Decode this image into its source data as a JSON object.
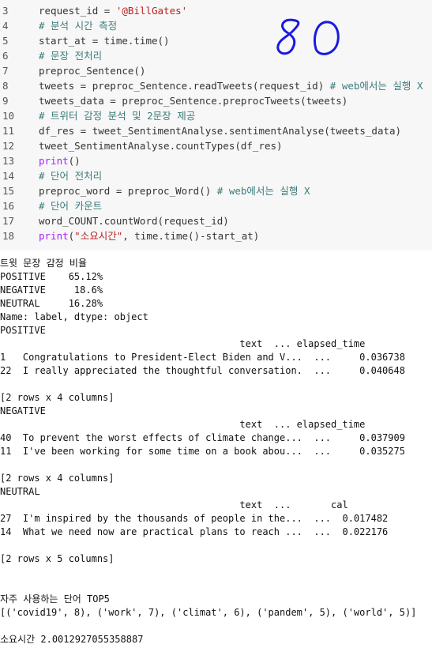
{
  "code_lines": [
    {
      "n": "3",
      "text": "request_id = '@BillGates'",
      "cls": "str-part",
      "parts": [
        {
          "t": "request_id = ",
          "c": ""
        },
        {
          "t": "'@BillGates'",
          "c": "str"
        }
      ]
    },
    {
      "n": "4",
      "parts": [
        {
          "t": "# 분석 시간 측정",
          "c": "cmt"
        }
      ]
    },
    {
      "n": "5",
      "parts": [
        {
          "t": "start_at = time.time()",
          "c": ""
        }
      ]
    },
    {
      "n": "6",
      "parts": [
        {
          "t": "# 문장 전처리",
          "c": "cmt"
        }
      ]
    },
    {
      "n": "7",
      "parts": [
        {
          "t": "preproc_Sentence()",
          "c": ""
        }
      ]
    },
    {
      "n": "8",
      "parts": [
        {
          "t": "tweets = preproc_Sentence.readTweets(request_id) ",
          "c": ""
        },
        {
          "t": "# web에서는 실행 X",
          "c": "cmt"
        }
      ]
    },
    {
      "n": "9",
      "parts": [
        {
          "t": "tweets_data = preproc_Sentence.preprocTweets(tweets)",
          "c": ""
        }
      ]
    },
    {
      "n": "10",
      "parts": [
        {
          "t": "# 트위터 감정 분석 및 2문장 제공",
          "c": "cmt"
        }
      ]
    },
    {
      "n": "11",
      "parts": [
        {
          "t": "df_res = tweet_SentimentAnalyse.sentimentAnalyse(tweets_data)",
          "c": ""
        }
      ]
    },
    {
      "n": "12",
      "parts": [
        {
          "t": "tweet_SentimentAnalyse.countTypes(df_res)",
          "c": ""
        }
      ]
    },
    {
      "n": "13",
      "parts": [
        {
          "t": "print",
          "c": "kw"
        },
        {
          "t": "()",
          "c": ""
        }
      ]
    },
    {
      "n": "14",
      "parts": [
        {
          "t": "# 단어 전처리",
          "c": "cmt"
        }
      ]
    },
    {
      "n": "15",
      "parts": [
        {
          "t": "preproc_word = preproc_Word() ",
          "c": ""
        },
        {
          "t": "# web에서는 실행 X",
          "c": "cmt"
        }
      ]
    },
    {
      "n": "16",
      "parts": [
        {
          "t": "# 단어 카운트",
          "c": "cmt"
        }
      ]
    },
    {
      "n": "17",
      "parts": [
        {
          "t": "word_COUNT.countWord(request_id)",
          "c": ""
        }
      ]
    },
    {
      "n": "18",
      "parts": [
        {
          "t": "print",
          "c": "kw"
        },
        {
          "t": "(",
          "c": ""
        },
        {
          "t": "\"소요시간\"",
          "c": "str"
        },
        {
          "t": ", time.time()-start_at)",
          "c": ""
        }
      ]
    }
  ],
  "handwritten_note": "80",
  "output_lines": [
    "트윗 문장 감정 비율",
    "POSITIVE    65.12%",
    "NEGATIVE     18.6%",
    "NEUTRAL     16.28%",
    "Name: label, dtype: object",
    "POSITIVE",
    "                                          text  ... elapsed_time",
    "1   Congratulations to President-Elect Biden and V...  ...     0.036738",
    "22  I really appreciated the thoughtful conversation.  ...     0.040648",
    "",
    "[2 rows x 4 columns]",
    "NEGATIVE",
    "                                          text  ... elapsed_time",
    "40  To prevent the worst effects of climate change...  ...     0.037909",
    "11  I've been working for some time on a book abou...  ...     0.035275",
    "",
    "[2 rows x 4 columns]",
    "NEUTRAL",
    "                                          text  ...       cal",
    "27  I'm inspired by the thousands of people in the...  ...  0.017482",
    "14  What we need now are practical plans to reach ...  ...  0.022176",
    "",
    "[2 rows x 5 columns]",
    "",
    "",
    "자주 사용하는 단어 TOP5",
    "[('covid19', 8), ('work', 7), ('climat', 6), ('pandem', 5), ('world', 5)]",
    "",
    "소요시간 2.0012927055358887"
  ],
  "colors": {
    "code_bg": "#f7f7f7",
    "string": "#ba2121",
    "comment": "#3d7b7b",
    "keyword": "#aa22ff",
    "handwriting": "#1a1adf"
  }
}
